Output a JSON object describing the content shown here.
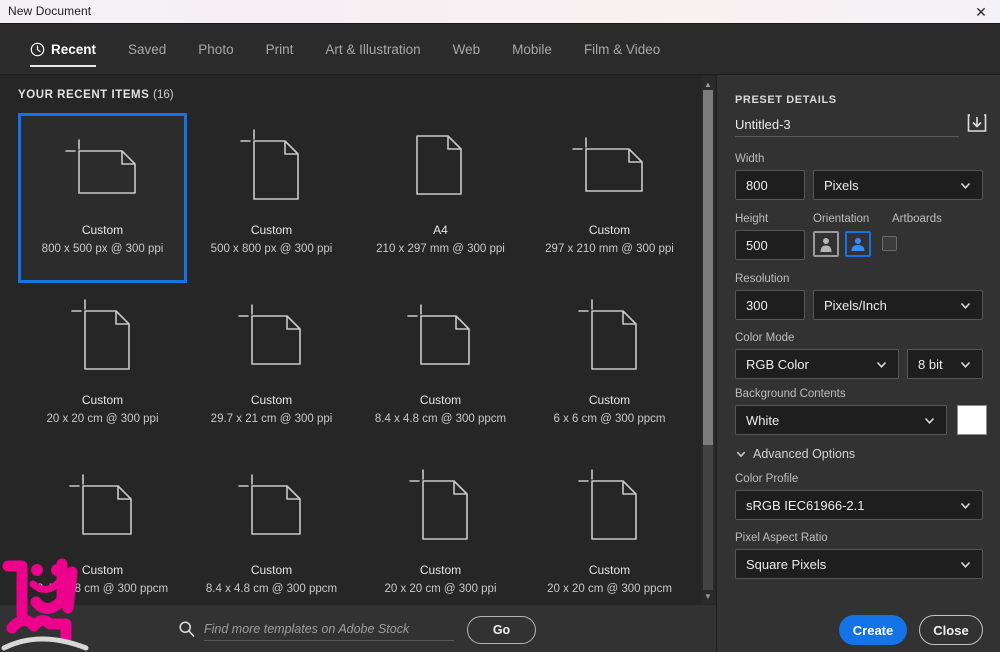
{
  "window": {
    "title": "New Document",
    "close_icon": "close-icon"
  },
  "tabs": [
    {
      "label": "Recent",
      "icon": "clock-icon",
      "active": true
    },
    {
      "label": "Saved",
      "active": false
    },
    {
      "label": "Photo",
      "active": false
    },
    {
      "label": "Print",
      "active": false
    },
    {
      "label": "Art & Illustration",
      "active": false
    },
    {
      "label": "Web",
      "active": false
    },
    {
      "label": "Mobile",
      "active": false
    },
    {
      "label": "Film & Video",
      "active": false
    }
  ],
  "recent": {
    "heading": "YOUR RECENT ITEMS",
    "count": "(16)",
    "items": [
      {
        "name": "Custom",
        "size": "800 x 500 px @ 300 ppi",
        "shape": "landscape",
        "crop": true,
        "selected": true
      },
      {
        "name": "Custom",
        "size": "500 x 800 px @ 300 ppi",
        "shape": "portrait",
        "crop": true,
        "selected": false
      },
      {
        "name": "A4",
        "size": "210 x 297 mm @ 300 ppi",
        "shape": "portrait",
        "crop": false,
        "selected": false
      },
      {
        "name": "Custom",
        "size": "297 x 210 mm @ 300 ppi",
        "shape": "landscape",
        "crop": true,
        "selected": false
      },
      {
        "name": "Custom",
        "size": "20 x 20 cm @ 300 ppi",
        "shape": "portrait",
        "crop": true,
        "selected": false
      },
      {
        "name": "Custom",
        "size": "29.7 x 21 cm @ 300 ppi",
        "shape": "square",
        "crop": true,
        "selected": false
      },
      {
        "name": "Custom",
        "size": "8.4 x 4.8 cm @ 300 ppcm",
        "shape": "square",
        "crop": true,
        "selected": false
      },
      {
        "name": "Custom",
        "size": "6 x 6 cm @ 300 ppcm",
        "shape": "portrait",
        "crop": true,
        "selected": false
      },
      {
        "name": "Custom",
        "size": "8.4 x 4.8 cm @ 300 ppcm",
        "shape": "square",
        "crop": true,
        "selected": false
      },
      {
        "name": "Custom",
        "size": "8.4 x 4.8 cm @ 300 ppcm",
        "shape": "square",
        "crop": true,
        "selected": false
      },
      {
        "name": "Custom",
        "size": "20 x 20 cm @ 300 ppi",
        "shape": "portrait",
        "crop": true,
        "selected": false
      },
      {
        "name": "Custom",
        "size": "20 x 20 cm @ 300 ppcm",
        "shape": "portrait",
        "crop": true,
        "selected": false
      }
    ]
  },
  "search": {
    "placeholder": "Find more templates on Adobe Stock",
    "value": "",
    "icon": "search-icon",
    "go_label": "Go"
  },
  "preset": {
    "title": "PRESET DETAILS",
    "name_value": "Untitled-3",
    "save_icon": "save-preset-icon",
    "width_label": "Width",
    "width_value": "800",
    "width_unit": "Pixels",
    "height_label": "Height",
    "height_value": "500",
    "orientation_label": "Orientation",
    "orientation_portrait": "portrait-icon",
    "orientation_landscape": "landscape-icon",
    "orientation_selected": "landscape",
    "artboards_label": "Artboards",
    "artboards_checked": false,
    "resolution_label": "Resolution",
    "resolution_value": "300",
    "resolution_unit": "Pixels/Inch",
    "color_mode_label": "Color Mode",
    "color_mode_value": "RGB Color",
    "bit_depth_value": "8 bit",
    "background_label": "Background Contents",
    "background_value": "White",
    "background_swatch": "#ffffff",
    "advanced_label": "Advanced Options",
    "color_profile_label": "Color Profile",
    "color_profile_value": "sRGB IEC61966-2.1",
    "pixel_aspect_label": "Pixel Aspect Ratio",
    "pixel_aspect_value": "Square Pixels"
  },
  "footer": {
    "create_label": "Create",
    "close_label": "Close"
  },
  "colors": {
    "accent": "#1473e6",
    "panel_bg": "#323232",
    "content_bg": "#262626",
    "tabbar_bg": "#2b2b2b"
  }
}
